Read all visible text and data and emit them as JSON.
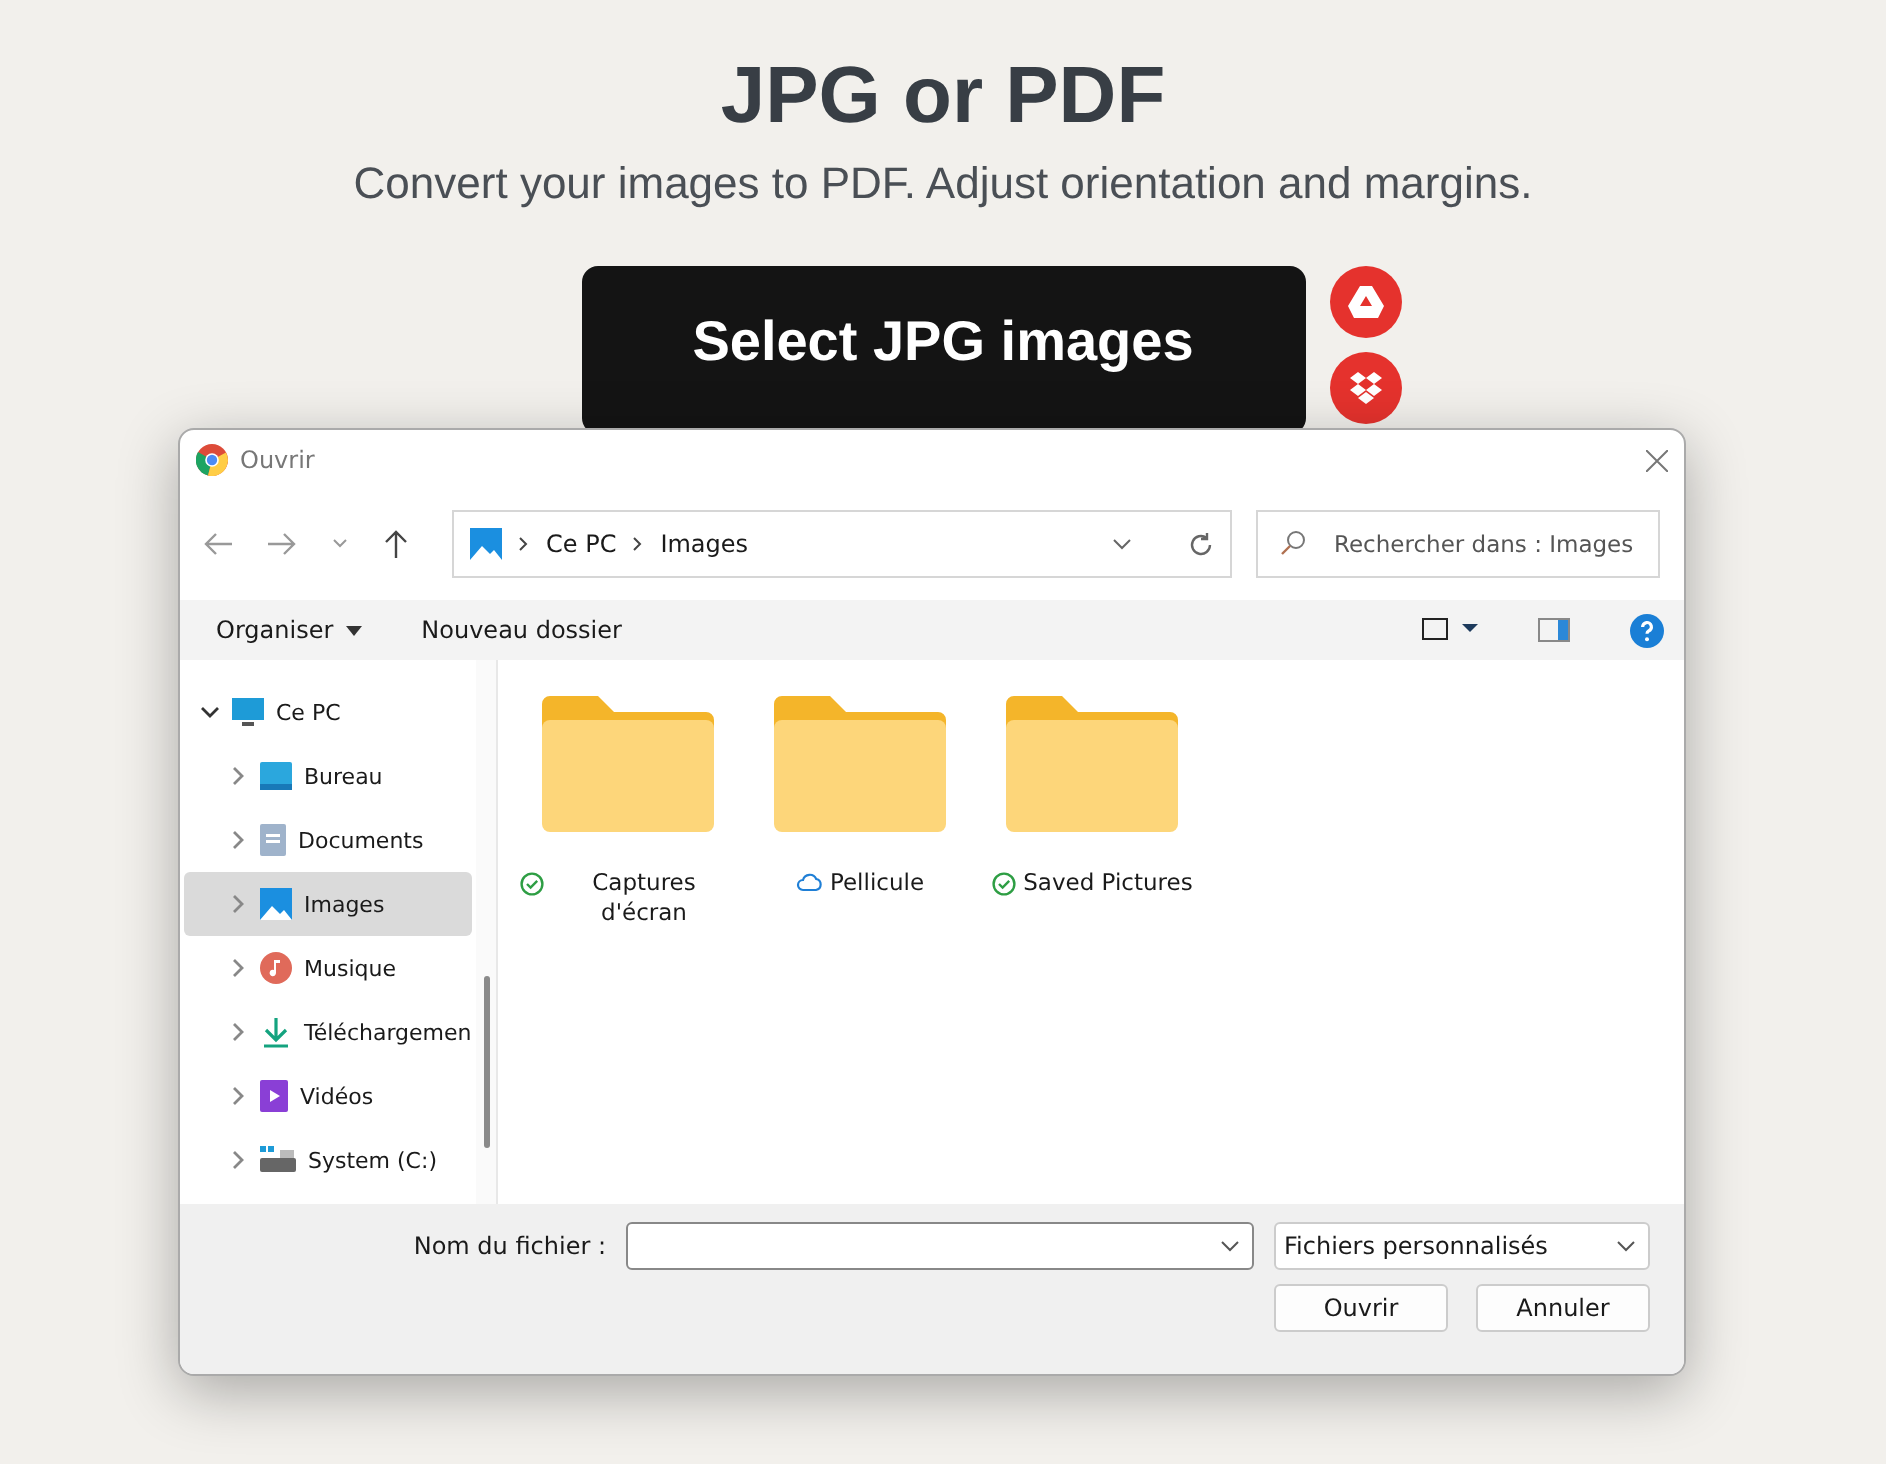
{
  "page": {
    "title": "JPG or PDF",
    "subtitle": "Convert your images to PDF. Adjust orientation and margins.",
    "select_button": "Select JPG images"
  },
  "dialog": {
    "title": "Ouvrir",
    "breadcrumb": [
      "Ce PC",
      "Images"
    ],
    "search": {
      "placeholder": "Rechercher dans : Images"
    },
    "commands": [
      {
        "label": "Organiser",
        "kind": "menu"
      },
      {
        "label": "Nouveau dossier",
        "kind": "plain"
      }
    ],
    "tree": [
      {
        "label": "Ce PC",
        "kind": "pc",
        "expanded": true,
        "selected": false,
        "children": [
          {
            "label": "Bureau",
            "kind": "desktop",
            "expanded": false,
            "selected": false
          },
          {
            "label": "Documents",
            "kind": "documents",
            "expanded": false,
            "selected": false
          },
          {
            "label": "Images",
            "kind": "images",
            "expanded": false,
            "selected": true
          },
          {
            "label": "Musique",
            "kind": "music",
            "expanded": false,
            "selected": false
          },
          {
            "label": "Téléchargemen",
            "kind": "download",
            "expanded": false,
            "selected": false
          },
          {
            "label": "Vidéos",
            "kind": "video",
            "expanded": false,
            "selected": false
          },
          {
            "label": "System (C:)",
            "kind": "drive",
            "expanded": false,
            "selected": false
          }
        ]
      }
    ],
    "folders": [
      {
        "name": "Captures d'écran",
        "kind": "synced"
      },
      {
        "name": "Pellicule",
        "kind": "cloud"
      },
      {
        "name": "Saved Pictures",
        "kind": "synced"
      }
    ],
    "filename_label": "Nom du fichier :",
    "filetype": "Fichiers personnalisés",
    "buttons": [
      "Ouvrir",
      "Annuler"
    ]
  }
}
